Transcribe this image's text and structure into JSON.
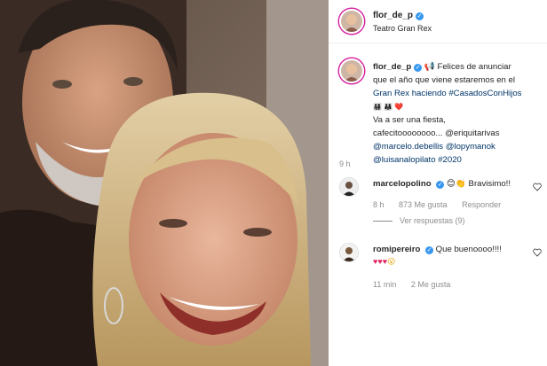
{
  "post": {
    "username": "flor_de_p",
    "location": "Teatro Gran Rex",
    "caption_lines": [
      "Felices de anunciar",
      "que el año que viene estaremos en el",
      "Gran Rex haciendo #CasadosConHijos",
      "Va a ser una fiesta,",
      "cafecitoooooooo... @eriquitarivas",
      "@marcelo.debellis @lopymanok",
      "@luisanalopilato #2020"
    ],
    "time": "9 h"
  },
  "comments": [
    {
      "username": "marcelopolino",
      "text": "Bravisimo!!",
      "time": "8 h",
      "likes": "873 Me gusta",
      "reply": "Responder",
      "replies": "Ver respuestas (9)"
    },
    {
      "username": "romipereiro",
      "text": "Que buenoooo!!!!",
      "time": "11 min",
      "likes": "2 Me gusta"
    }
  ],
  "colors": {
    "verified": "#3897f0",
    "link": "#003569",
    "muted": "#8e8e8e",
    "heart": "#e0245e"
  },
  "icons": [
    "verified-icon",
    "megaphone-icon",
    "heart-outline-icon"
  ]
}
